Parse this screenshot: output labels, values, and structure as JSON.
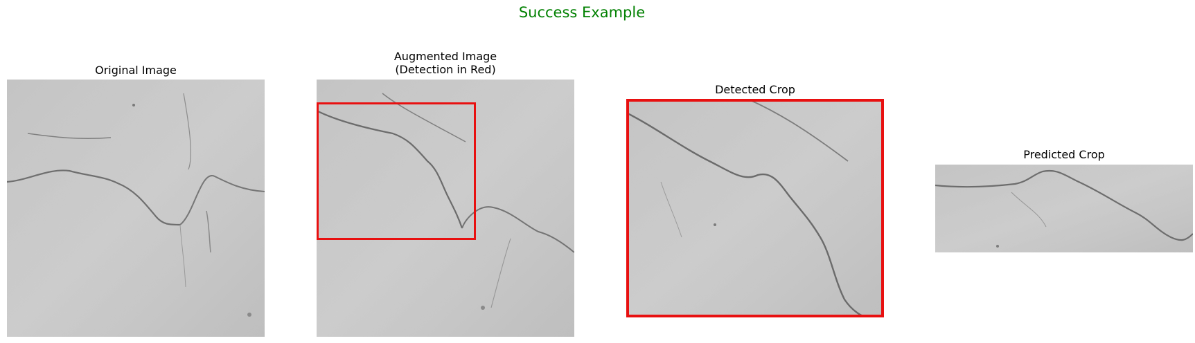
{
  "figure": {
    "suptitle": "Success Example",
    "suptitle_color": "#008000",
    "highlight_color": "#e81010"
  },
  "panels": [
    {
      "title": "Original Image",
      "content": "concrete-crack-photo"
    },
    {
      "title": "Augmented Image\n(Detection in Red)",
      "content": "concrete-crack-photo-with-detection-box"
    },
    {
      "title": "Detected Crop",
      "content": "cropped-crack-region"
    },
    {
      "title": "Predicted Crop",
      "content": "predicted-crack-region"
    }
  ]
}
